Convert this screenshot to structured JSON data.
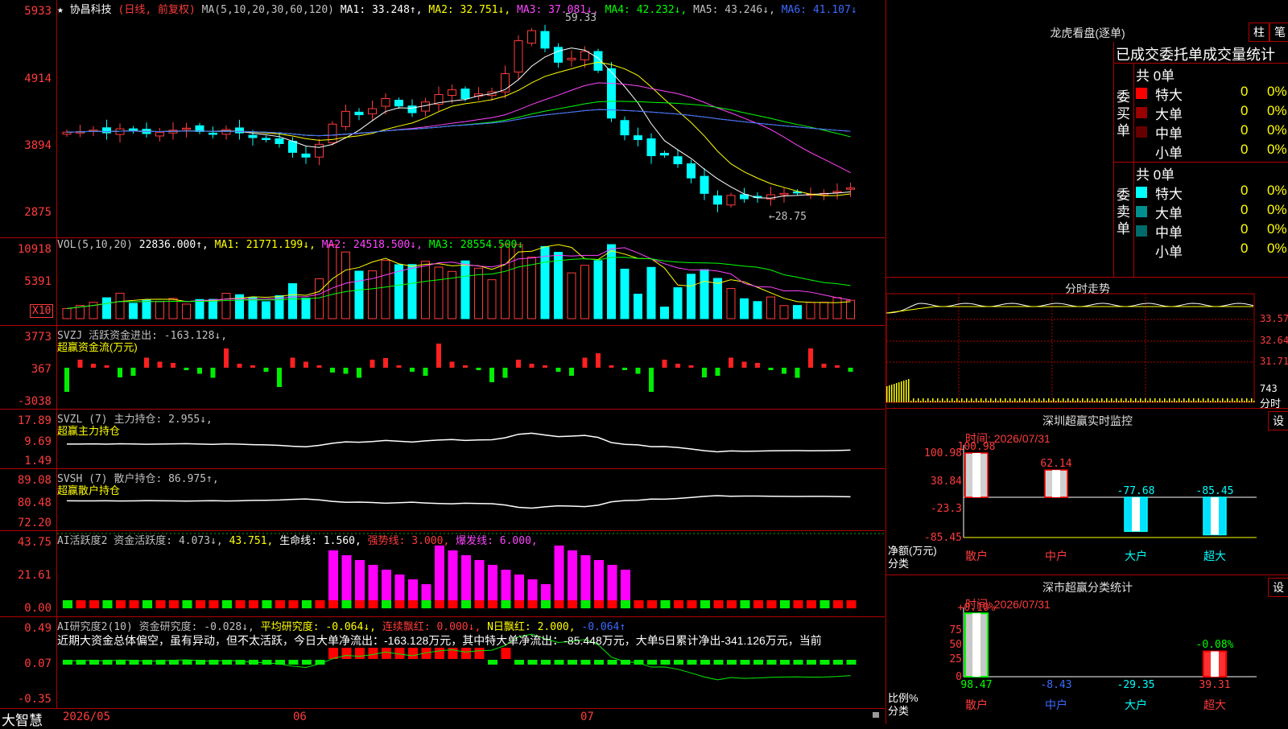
{
  "kline": {
    "star": "★",
    "name": "协昌科技",
    "mode": "(日线, 前复权)",
    "ma_label": "MA(5,10,20,30,60,120)",
    "ma1": "MA1: 33.248↑,",
    "ma2": "MA2: 32.751↓,",
    "ma3": "MA3: 37.081↓,",
    "ma4": "MA4: 42.232↓,",
    "ma5": "MA5: 43.246↓,",
    "ma6": "MA6: 41.107↓",
    "y_labels": [
      "5933",
      "4914",
      "3894",
      "2875"
    ],
    "high_label": "59.33",
    "low_label": "←28.75"
  },
  "vol": {
    "header": "VOL(5,10,20)",
    "value": "22836.000↑,",
    "ma1": "MA1: 21771.199↓,",
    "ma2": "MA2: 24518.500↓,",
    "ma3": "MA3: 28554.500↓",
    "y_labels": [
      "10918",
      "5391"
    ],
    "unit": "X10"
  },
  "svzj": {
    "header": "SVZJ  活跃资金进出: -163.128↓,",
    "sub": "超赢资金流(万元)",
    "y_labels": [
      "3773",
      "367",
      "-3038"
    ]
  },
  "svzl": {
    "header": "SVZL (7) 主力持仓: 2.955↓,",
    "sub": "超赢主力持仓",
    "y_labels": [
      "17.89",
      "9.69",
      "1.49"
    ]
  },
  "svsh": {
    "header": "SVSH (7) 散户持仓: 86.975↑,",
    "sub": "超赢散户持仓",
    "y_labels": [
      "89.08",
      "80.48",
      "72.20"
    ]
  },
  "ai_act": {
    "h1": "AI活跃度2 资金活跃度: 4.073↓,",
    "h2": "43.751,",
    "h3": "生命线: 1.560,",
    "h4": "强势线: 3.000,",
    "h5": "爆发线: 6.000,",
    "y_labels": [
      "43.75",
      "21.61",
      "0.00"
    ]
  },
  "ai_res": {
    "h1": "AI研究度2(10) 资金研究度: -0.028↓,",
    "h2": "平均研究度: -0.064↓,",
    "h3": "连续飘红: 0.000↓,",
    "h4": "N日飘红: 2.000,",
    "h5": "-0.064↑",
    "desc": "近期大资金总体偏空，虽有异动，但不太活跃，今日大单净流出：-163.128万元，其中特大单净流出：-85.448万元，大单5日累计净出-341.126万元，当前",
    "y_labels": [
      "0.49",
      "0.07",
      "-0.35"
    ]
  },
  "footer": {
    "brand": "大智慧",
    "dates": [
      "2026/05",
      "06",
      "07"
    ]
  },
  "longhu": {
    "title": "龙虎看盘(逐单)",
    "btn1": "柱",
    "btn2": "笔",
    "subtitle": "已成交委托单成交量统计",
    "buy_label": "委买单",
    "sell_label": "委卖单",
    "buy_total": "共 0单",
    "sell_total": "共 0单",
    "buy_rows": [
      {
        "name": "特大",
        "count": "0",
        "pct": "0%",
        "color": "#ff0000"
      },
      {
        "name": "大单",
        "count": "0",
        "pct": "0%",
        "color": "#990000"
      },
      {
        "name": "中单",
        "count": "0",
        "pct": "0%",
        "color": "#660000"
      },
      {
        "name": "小单",
        "count": "0",
        "pct": "0%",
        "color": "#000000"
      }
    ],
    "sell_rows": [
      {
        "name": "特大",
        "count": "0",
        "pct": "0%",
        "color": "#00ffff"
      },
      {
        "name": "大单",
        "count": "0",
        "pct": "0%",
        "color": "#008f8f"
      },
      {
        "name": "中单",
        "count": "0",
        "pct": "0%",
        "color": "#006b6b"
      },
      {
        "name": "小单",
        "count": "0",
        "pct": "0%",
        "color": "#000000"
      }
    ]
  },
  "fenshi": {
    "title": "分时走势",
    "y_labels": [
      "33.57",
      "32.64",
      "31.71",
      "743"
    ],
    "unit": "分时"
  },
  "sz_monitor": {
    "title": "深圳超赢实时监控",
    "btn": "设",
    "time": "时间: 2026/07/31",
    "y_labels": [
      "100.98",
      "38.84",
      "-23.3",
      "-85.45"
    ],
    "axis_title1": "净额(万元)",
    "axis_title2": "分类",
    "bar_values": [
      "100.98",
      "62.14",
      "-77.68",
      "-85.45"
    ],
    "categories": [
      "散户",
      "中户",
      "大户",
      "超大"
    ]
  },
  "sz_stats": {
    "title": "深市超赢分类统计",
    "btn": "设",
    "time": "时间: 2026/07/31",
    "y_labels": [
      "75",
      "50",
      "25",
      "0"
    ],
    "axis_title1": "比例%",
    "axis_title2": "分类",
    "top_labels": [
      "+0.10%",
      "-0.08%"
    ],
    "bottom_values": [
      "98.47",
      "-8.43",
      "-29.35",
      "39.31"
    ],
    "categories": [
      "散户",
      "中户",
      "大户",
      "超大"
    ]
  },
  "chart_data": [
    {
      "type": "candlestick",
      "title": "协昌科技",
      "y_ticks": [
        59.33,
        49.14,
        38.94,
        28.75
      ],
      "high": 59.33,
      "low": 28.75,
      "closes": [
        42.3,
        42.4,
        42.6,
        42.2,
        42.8,
        42.5,
        42.1,
        42.3,
        42.6,
        42.9,
        42.4,
        42.0,
        42.7,
        42.2,
        41.5,
        41.2,
        40.6,
        39.3,
        38.6,
        40.5,
        43.5,
        45.4,
        44.9,
        45.8,
        47.3,
        46.2,
        45.2,
        46.8,
        47.9,
        48.6,
        47.3,
        48.0,
        48.3,
        51.0,
        55.9,
        57.4,
        54.8,
        52.7,
        53.3,
        54.3,
        51.5,
        44.4,
        41.9,
        41.2,
        38.8,
        38.9,
        37.6,
        35.5,
        33.2,
        31.6,
        32.9,
        32.4,
        32.6,
        33.0,
        33.2,
        33.3,
        33.1,
        33.2,
        33.5,
        34.0
      ]
    },
    {
      "type": "bar",
      "title": "深圳超赢实时监控",
      "categories": [
        "散户",
        "中户",
        "大户",
        "超大"
      ],
      "values": [
        100.98,
        62.14,
        -77.68,
        -85.45
      ],
      "ylabel": "净额(万元)"
    },
    {
      "type": "bar",
      "title": "深市超赢分类统计",
      "categories": [
        "散户",
        "中户",
        "大户",
        "超大"
      ],
      "values": [
        98.47,
        -8.43,
        -29.35,
        39.31
      ],
      "ylabel": "比例%"
    }
  ]
}
